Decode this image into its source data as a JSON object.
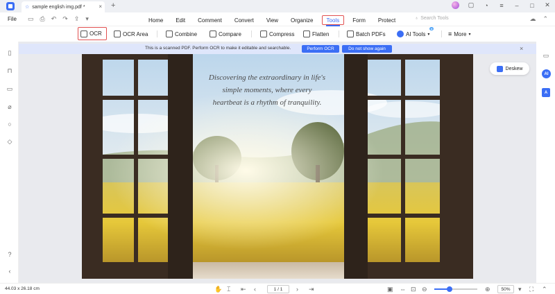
{
  "tab": {
    "title": "sample english img.pdf *"
  },
  "menu": {
    "file": "File",
    "items": [
      "Home",
      "Edit",
      "Comment",
      "Convert",
      "View",
      "Organize",
      "Tools",
      "Form",
      "Protect"
    ],
    "search_placeholder": "Search Tools"
  },
  "toolbar": {
    "ocr": "OCR",
    "ocr_area": "OCR Area",
    "combine": "Combine",
    "compare": "Compare",
    "compress": "Compress",
    "flatten": "Flatten",
    "batch_pdfs": "Batch PDFs",
    "ai_tools": "AI Tools",
    "more": "More"
  },
  "banner": {
    "message": "This is a scanned PDF. Perform OCR to make it editable and searchable.",
    "perform_ocr": "Perform OCR",
    "dont_show": "Do not show again"
  },
  "document": {
    "quote_line1": "Discovering the extraordinary in life's",
    "quote_line2": "simple moments, where every",
    "quote_line3": "heartbeat is a rhythm of tranquility."
  },
  "deskew": "Deskew",
  "right_sidebar": {
    "ai_label": "AI"
  },
  "status": {
    "dimensions": "44.03 x 26.18 cm",
    "page": "1 / 1",
    "zoom": "50%",
    "zoom_fraction": 0.35
  },
  "colors": {
    "accent": "#3b6ef5",
    "highlight_border": "#e25050"
  }
}
